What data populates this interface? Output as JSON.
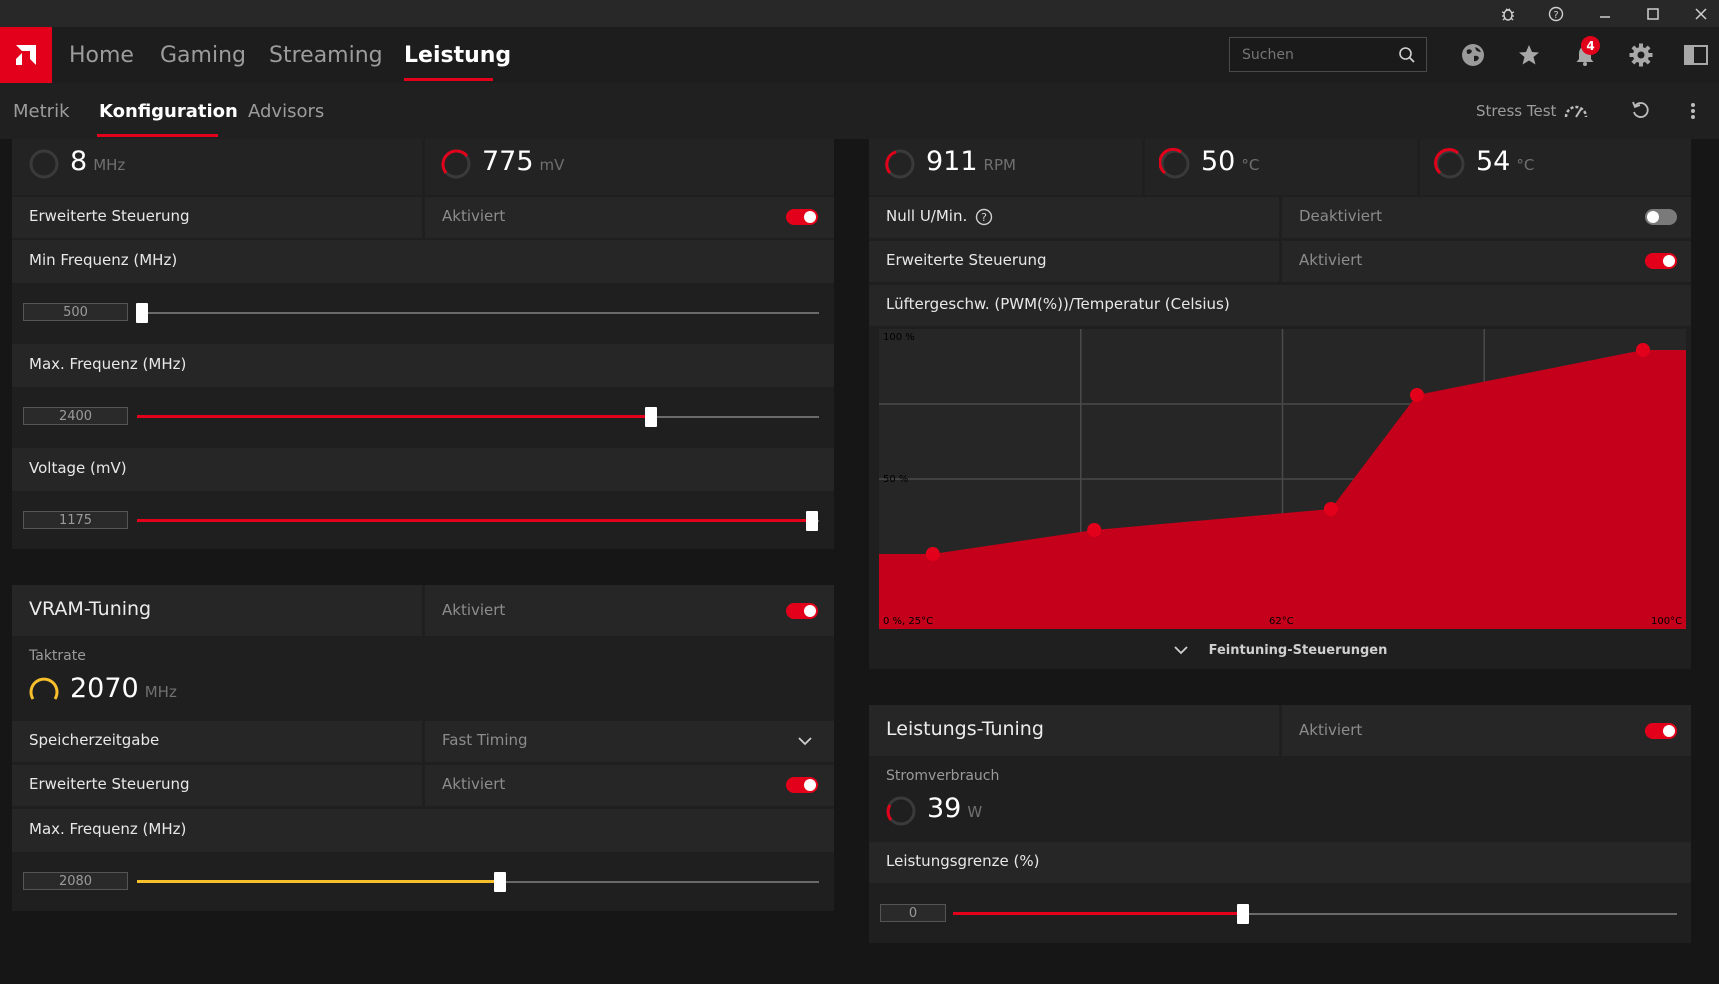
{
  "window": {
    "bug_icon": "bug-icon",
    "help_icon": "help-icon",
    "minimize_icon": "minimize-icon",
    "maximize_icon": "maximize-icon",
    "close_icon": "close-icon"
  },
  "nav": {
    "tabs": [
      "Home",
      "Gaming",
      "Streaming",
      "Leistung"
    ],
    "active": "Leistung",
    "search_placeholder": "Suchen",
    "notification_count": "4"
  },
  "subnav": {
    "tabs": [
      "Metrik",
      "Konfiguration",
      "Advisors"
    ],
    "active": "Konfiguration",
    "stress_test": "Stress Test"
  },
  "gpu": {
    "clock_value": "8",
    "clock_unit": "MHz",
    "voltage_value": "775",
    "voltage_unit": "mV",
    "advanced_label": "Erweiterte Steuerung",
    "advanced_status": "Aktiviert",
    "min_freq_label": "Min Frequenz (MHz)",
    "min_freq_value": "500",
    "min_freq_fraction": 0.0,
    "max_freq_label": "Max. Frequenz (MHz)",
    "max_freq_value": "2400",
    "max_freq_fraction": 0.75,
    "voltage_label": "Voltage (mV)",
    "voltage_slider_value": "1175",
    "voltage_fraction": 1.0
  },
  "vram": {
    "title": "VRAM-Tuning",
    "status": "Aktiviert",
    "clock_label": "Taktrate",
    "clock_value": "2070",
    "clock_unit": "MHz",
    "timing_label": "Speicherzeitgabe",
    "timing_value": "Fast Timing",
    "advanced_label": "Erweiterte Steuerung",
    "advanced_status": "Aktiviert",
    "max_freq_label": "Max. Frequenz (MHz)",
    "max_freq_value": "2080",
    "max_freq_fraction": 0.53
  },
  "fan": {
    "rpm_value": "911",
    "rpm_unit": "RPM",
    "temp1_value": "50",
    "temp1_unit": "°C",
    "temp2_value": "54",
    "temp2_unit": "°C",
    "zero_rpm_label": "Null U/Min.",
    "zero_rpm_status": "Deaktiviert",
    "advanced_label": "Erweiterte Steuerung",
    "advanced_status": "Aktiviert",
    "curve_label": "Lüftergeschw. (PWM(%))/Temperatur (Celsius)",
    "fine_tuning": "Feintuning-Steuerungen"
  },
  "chart_data": {
    "type": "area",
    "title": "Lüftergeschw. (PWM(%))/Temperatur (Celsius)",
    "x_tick_labels": [
      "0 %, 25°C",
      "62°C",
      "100°C"
    ],
    "y_tick_labels": [
      "100 %",
      "50 %"
    ],
    "xlim": [
      25,
      100
    ],
    "ylim": [
      0,
      100
    ],
    "points": [
      {
        "x": 30,
        "y": 25
      },
      {
        "x": 45,
        "y": 33
      },
      {
        "x": 67,
        "y": 40
      },
      {
        "x": 75,
        "y": 78
      },
      {
        "x": 96,
        "y": 93
      }
    ],
    "fill_color": "#c5001a",
    "point_color": "#e2001a"
  },
  "power": {
    "title": "Leistungs-Tuning",
    "status": "Aktiviert",
    "consumption_label": "Stromverbrauch",
    "consumption_value": "39",
    "consumption_unit": "W",
    "limit_label": "Leistungsgrenze (%)",
    "limit_value": "0",
    "limit_fraction": 0.5
  },
  "colors": {
    "accent": "#e2001a",
    "vram_accent": "#f5c02c"
  }
}
